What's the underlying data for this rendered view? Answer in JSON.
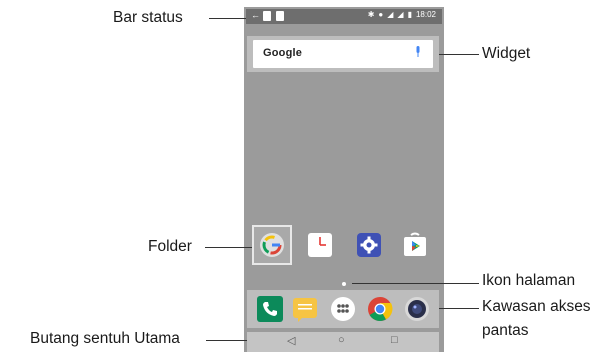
{
  "labels": {
    "status_bar": "Bar status",
    "widget": "Widget",
    "folder": "Folder",
    "page_icon": "Ikon halaman",
    "quick_access_line1": "Kawasan akses",
    "quick_access_line2": "pantas",
    "home_touch": "Butang sentuh Utama"
  },
  "phone": {
    "status_time": "18:02",
    "search_brand": "Google",
    "nav_back": "◁",
    "nav_home": "○",
    "nav_recent": "□"
  },
  "colors": {
    "screen": "#9b9b9b",
    "phone_green": "#0c8a5a",
    "messages_yellow": "#f6c443",
    "chrome_red": "#db4437",
    "chrome_yellow": "#f4c20d",
    "chrome_green": "#0f9d58",
    "chrome_blue": "#4285f4"
  },
  "icons": {
    "folder": "google-folder-icon",
    "clock": "clock-icon",
    "settings": "gear-icon",
    "store": "play-store-icon",
    "phone": "phone-icon",
    "messages": "messages-icon",
    "apps": "apps-grid-icon",
    "chrome": "chrome-icon",
    "camera": "camera-icon"
  }
}
